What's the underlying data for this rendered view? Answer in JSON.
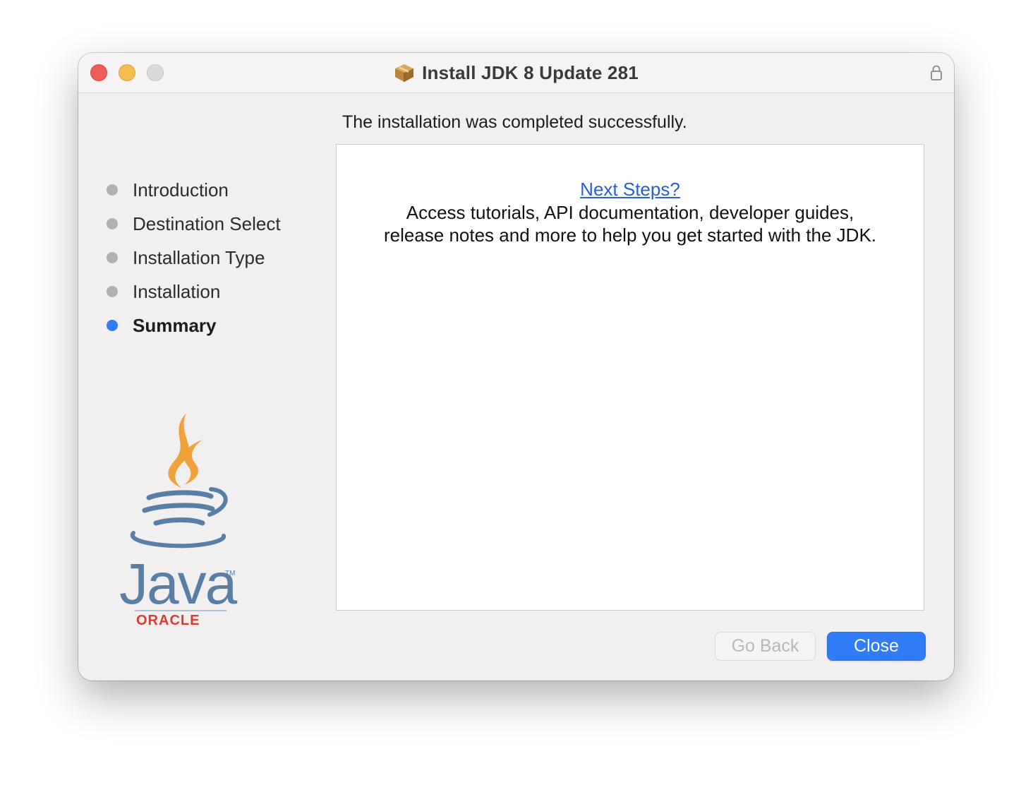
{
  "window": {
    "title": "Install JDK 8 Update 281"
  },
  "main": {
    "headline": "The installation was completed successfully.",
    "link_text": "Next Steps?",
    "description_line1": "Access tutorials, API documentation, developer guides,",
    "description_line2": "release notes and more to help you get started with the JDK."
  },
  "sidebar": {
    "steps": [
      {
        "label": "Introduction",
        "active": false
      },
      {
        "label": "Destination Select",
        "active": false
      },
      {
        "label": "Installation Type",
        "active": false
      },
      {
        "label": "Installation",
        "active": false
      },
      {
        "label": "Summary",
        "active": true
      }
    ],
    "logo": {
      "wordmark": "Java",
      "trademark": "TM",
      "vendor": "ORACLE"
    }
  },
  "buttons": {
    "back_label": "Go Back",
    "close_label": "Close"
  },
  "colors": {
    "accent": "#2f7cf6",
    "link": "#2a5fd0",
    "java_blue": "#5a7fa6",
    "java_orange": "#f0a33a",
    "oracle_red": "#e03a2f"
  },
  "icons": {
    "title": "package-icon",
    "lock": "lock-icon"
  }
}
